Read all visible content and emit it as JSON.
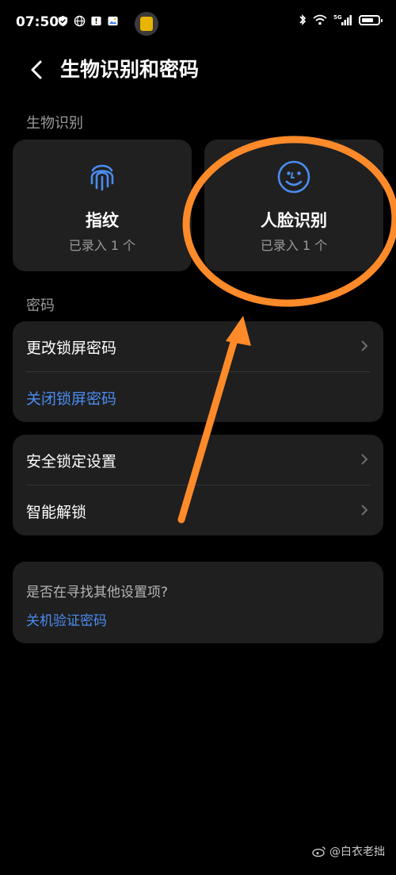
{
  "status_bar": {
    "time": "07:50",
    "network": "5G",
    "battery_level": 0.75
  },
  "header": {
    "title": "生物识别和密码"
  },
  "biometrics": {
    "section_label": "生物识别",
    "cards": [
      {
        "title": "指纹",
        "subtitle": "已录入 1 个",
        "icon": "fingerprint-icon"
      },
      {
        "title": "人脸识别",
        "subtitle": "已录入 1 个",
        "icon": "face-icon"
      }
    ]
  },
  "password": {
    "section_label": "密码",
    "items": [
      {
        "label": "更改锁屏密码"
      },
      {
        "label": "关闭锁屏密码"
      }
    ]
  },
  "security": {
    "items": [
      {
        "label": "安全锁定设置"
      },
      {
        "label": "智能解锁"
      }
    ]
  },
  "find": {
    "question": "是否在寻找其他设置项?",
    "link": "关机验证密码"
  },
  "watermark": {
    "text": "@白衣老拙"
  },
  "colors": {
    "accent": "#4b8cf0",
    "card_bg": "#202020",
    "annotation": "#ff8a2a"
  }
}
